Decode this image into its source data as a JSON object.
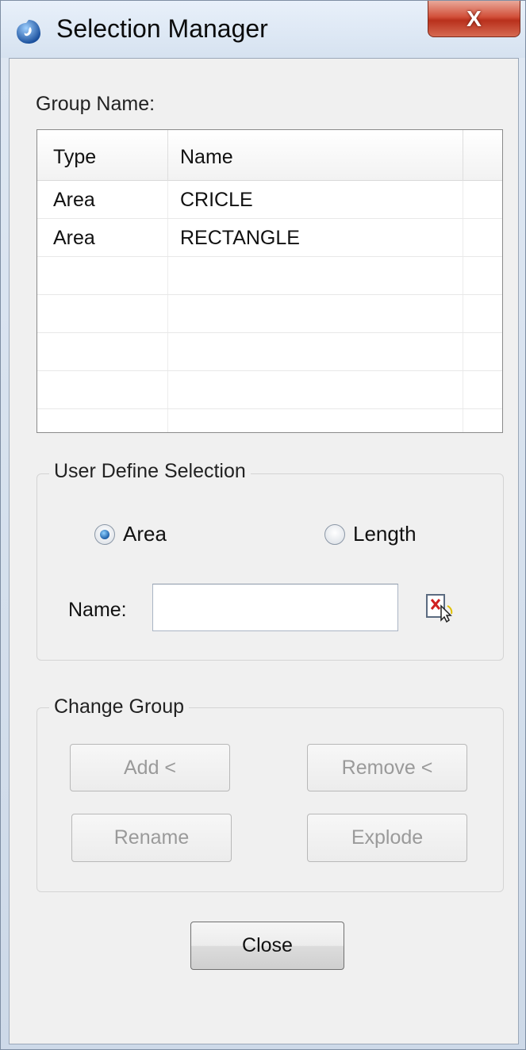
{
  "window": {
    "title": "Selection Manager",
    "close_label": "X"
  },
  "group_name_label": "Group Name:",
  "table": {
    "columns": [
      "Type",
      "Name"
    ],
    "rows": [
      {
        "type": "Area",
        "name": "CRICLE"
      },
      {
        "type": "Area",
        "name": "RECTANGLE"
      }
    ]
  },
  "user_define": {
    "title": "User Define Selection",
    "radio_area": "Area",
    "radio_length": "Length",
    "selected": "Area",
    "name_label": "Name:",
    "name_value": ""
  },
  "change_group": {
    "title": "Change Group",
    "add": "Add <",
    "remove": "Remove <",
    "rename": "Rename",
    "explode": "Explode"
  },
  "close_button": "Close",
  "colors": {
    "accent_radio": "#1d5fa8",
    "close_red": "#c63a23"
  }
}
